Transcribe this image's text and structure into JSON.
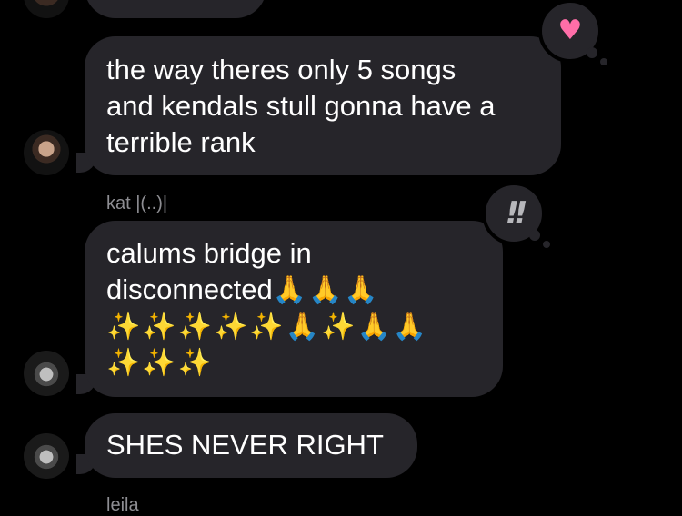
{
  "messages": [
    {
      "lines": [
        "the way theres only 5 songs",
        "and kendals stull gonna have a",
        "terrible rank"
      ],
      "reaction": "heart"
    },
    {
      "sender": "kat |(..)|",
      "lines": [
        "calums bridge in",
        "disconnected"
      ],
      "emoji_line1": "🙏🙏🙏",
      "emoji_line2": "✨✨✨✨✨🙏✨🙏🙏",
      "emoji_line3": "✨✨✨",
      "reaction": "exclamation"
    },
    {
      "lines": [
        "SHES NEVER RIGHT"
      ]
    }
  ],
  "next_sender_partial": "leila",
  "reactions": {
    "heart_icon": "♥",
    "exclamation_icon": "!!"
  },
  "colors": {
    "background": "#000000",
    "bubble": "#26252a",
    "text": "#ffffff",
    "sender": "#8e8e93",
    "heart": "#ff6ea8"
  }
}
